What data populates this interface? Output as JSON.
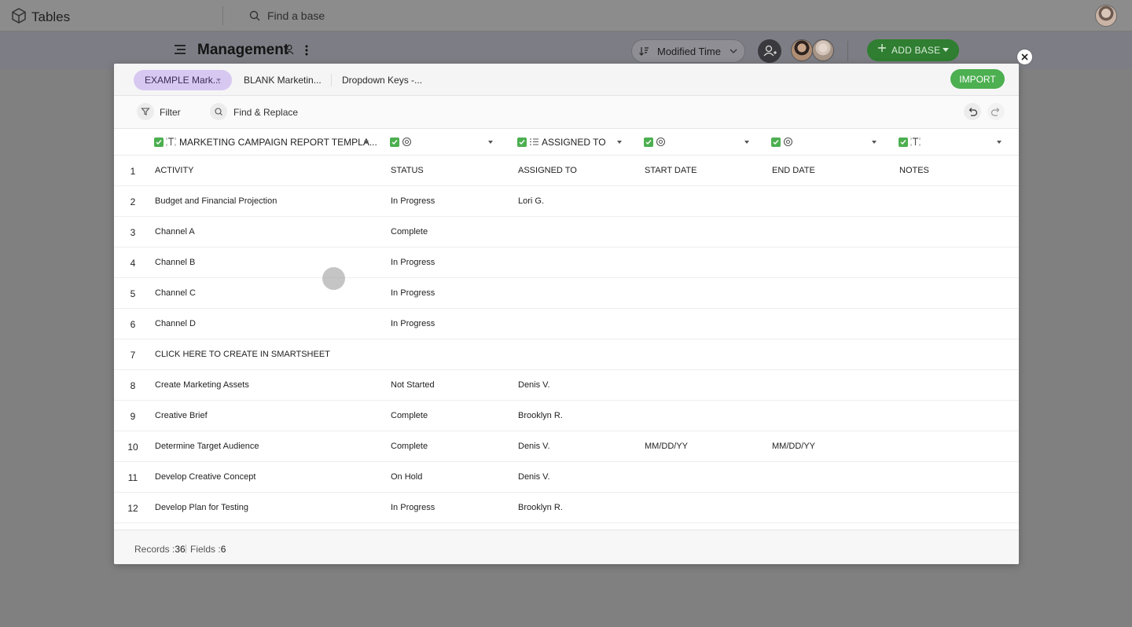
{
  "app": {
    "name": "Tables"
  },
  "topbar": {
    "search_placeholder": "Find a base"
  },
  "header": {
    "title": "Management",
    "sort_label": "Modified Time",
    "add_base_label": "ADD BASE"
  },
  "sheet_tabs": [
    {
      "label": "EXAMPLE Mark..."
    },
    {
      "label": "BLANK Marketin..."
    },
    {
      "label": "Dropdown Keys -..."
    }
  ],
  "import_label": "IMPORT",
  "toolbar": {
    "filter_label": "Filter",
    "find_replace_label": "Find & Replace"
  },
  "columns": [
    {
      "name": "MARKETING CAMPAIGN REPORT TEMPLA...",
      "type_icon": "text-icon"
    },
    {
      "name": "",
      "type_icon": "status-icon"
    },
    {
      "name": "ASSIGNED TO",
      "type_icon": "list-icon"
    },
    {
      "name": "",
      "type_icon": "status-icon"
    },
    {
      "name": "",
      "type_icon": "status-icon"
    },
    {
      "name": "",
      "type_icon": "text-icon"
    }
  ],
  "rows": [
    {
      "num": "1",
      "activity": "ACTIVITY",
      "status": "STATUS",
      "assigned": "ASSIGNED TO",
      "start": "START DATE",
      "end": "END DATE",
      "notes": "NOTES"
    },
    {
      "num": "2",
      "activity": "Budget and Financial Projection",
      "status": "In Progress",
      "assigned": "Lori G.",
      "start": "",
      "end": "",
      "notes": ""
    },
    {
      "num": "3",
      "activity": "Channel A",
      "status": "Complete",
      "assigned": "",
      "start": "",
      "end": "",
      "notes": ""
    },
    {
      "num": "4",
      "activity": "Channel B",
      "status": "In Progress",
      "assigned": "",
      "start": "",
      "end": "",
      "notes": ""
    },
    {
      "num": "5",
      "activity": "Channel C",
      "status": "In Progress",
      "assigned": "",
      "start": "",
      "end": "",
      "notes": ""
    },
    {
      "num": "6",
      "activity": "Channel D",
      "status": "In Progress",
      "assigned": "",
      "start": "",
      "end": "",
      "notes": ""
    },
    {
      "num": "7",
      "activity": "CLICK HERE TO CREATE IN SMARTSHEET",
      "status": "",
      "assigned": "",
      "start": "",
      "end": "",
      "notes": ""
    },
    {
      "num": "8",
      "activity": "Create Marketing Assets",
      "status": "Not Started",
      "assigned": "Denis V.",
      "start": "",
      "end": "",
      "notes": ""
    },
    {
      "num": "9",
      "activity": "Creative Brief",
      "status": "Complete",
      "assigned": "Brooklyn R.",
      "start": "",
      "end": "",
      "notes": ""
    },
    {
      "num": "10",
      "activity": "Determine Target Audience",
      "status": "Complete",
      "assigned": "Denis V.",
      "start": "MM/DD/YY",
      "end": "MM/DD/YY",
      "notes": ""
    },
    {
      "num": "11",
      "activity": "Develop Creative Concept",
      "status": "On Hold",
      "assigned": "Denis V.",
      "start": "",
      "end": "",
      "notes": ""
    },
    {
      "num": "12",
      "activity": "Develop Plan for Testing",
      "status": "In Progress",
      "assigned": "Brooklyn R.",
      "start": "",
      "end": "",
      "notes": ""
    }
  ],
  "footer": {
    "records_label": "Records :",
    "records_value": "36",
    "fields_label": "Fields :",
    "fields_value": "6"
  },
  "colors": {
    "accent_green": "#4caf50",
    "active_tab": "#d7c8f1",
    "overlay": "#808080"
  }
}
